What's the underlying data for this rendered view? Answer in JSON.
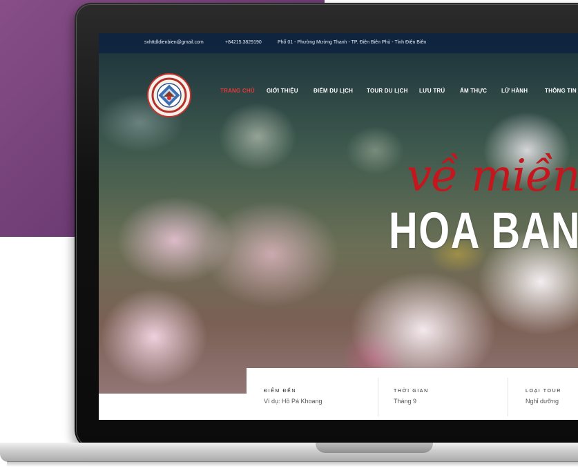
{
  "topbar": {
    "email": "svhttdldienbien@gmail.com",
    "phone": "+84215.3829190",
    "address": "Phố 01 - Phường Mường Thanh - TP. Điện Biên Phủ - Tỉnh Điện Biên"
  },
  "nav": [
    {
      "label": "TRANG CHỦ",
      "active": true
    },
    {
      "label": "GIỚI THIỆU"
    },
    {
      "label": "ĐIỂM DU LỊCH"
    },
    {
      "label": "TOUR DU LỊCH"
    },
    {
      "label": "LƯU TRÚ"
    },
    {
      "label": "ẨM THỰC"
    },
    {
      "label": "LỮ HÀNH"
    },
    {
      "label": "THÔNG TIN HỮ"
    }
  ],
  "hero": {
    "script_text": "về miền",
    "big_text": "HOA BAN"
  },
  "search": {
    "fields": [
      {
        "label": "ĐIỂM ĐẾN",
        "value": "Ví dụ: Hồ Pá Khoang"
      },
      {
        "label": "THỜI GIAN",
        "value": "Tháng 9"
      },
      {
        "label": "LOẠI TOUR",
        "value": "Nghỉ dưỡng"
      }
    ]
  },
  "colors": {
    "purple_bg": "#7a4680",
    "topbar_bg": "#0e2440",
    "nav_active": "#e23a3a",
    "script_red": "#c4161c"
  }
}
